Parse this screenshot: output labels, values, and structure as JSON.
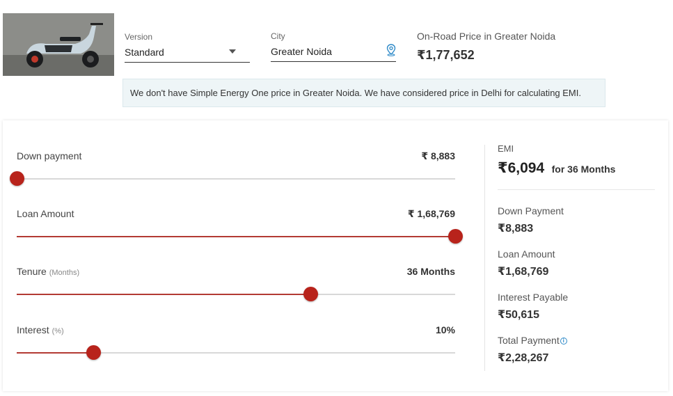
{
  "vehicle": {
    "image_alt": "Simple Energy One scooter"
  },
  "version": {
    "label": "Version",
    "value": "Standard"
  },
  "city": {
    "label": "City",
    "value": "Greater Noida"
  },
  "on_road": {
    "label": "On-Road Price in Greater Noida",
    "price": "₹1,77,652"
  },
  "notice": "We don't have Simple Energy One price in Greater Noida. We have considered price in Delhi for calculating EMI.",
  "sliders": {
    "down_payment": {
      "label": "Down payment",
      "value": "₹  8,883",
      "fraction": 0.0
    },
    "loan_amount": {
      "label": "Loan Amount",
      "value": "₹  1,68,769",
      "fraction": 1.0
    },
    "tenure": {
      "label": "Tenure",
      "sub": "(Months)",
      "value": "36 Months",
      "fraction": 0.67
    },
    "interest": {
      "label": "Interest",
      "sub": "(%)",
      "value": "10%",
      "fraction": 0.175
    }
  },
  "summary": {
    "emi_label": "EMI",
    "emi_value": "₹6,094",
    "emi_tenure": "for 36 Months",
    "down_payment_label": "Down Payment",
    "down_payment_value": "₹8,883",
    "loan_amount_label": "Loan Amount",
    "loan_amount_value": "₹1,68,769",
    "interest_label": "Interest Payable",
    "interest_value": "₹50,615",
    "total_label": "Total Payment",
    "total_value": "₹2,28,267"
  },
  "colors": {
    "slider_active": "#b33a33",
    "knob": "#b8231b",
    "notice_bg": "#eef5f7",
    "info_icon": "#2e8ac8"
  },
  "icons": {
    "dropdown": "caret-down-icon",
    "location": "location-pin-icon",
    "info": "info-icon"
  }
}
